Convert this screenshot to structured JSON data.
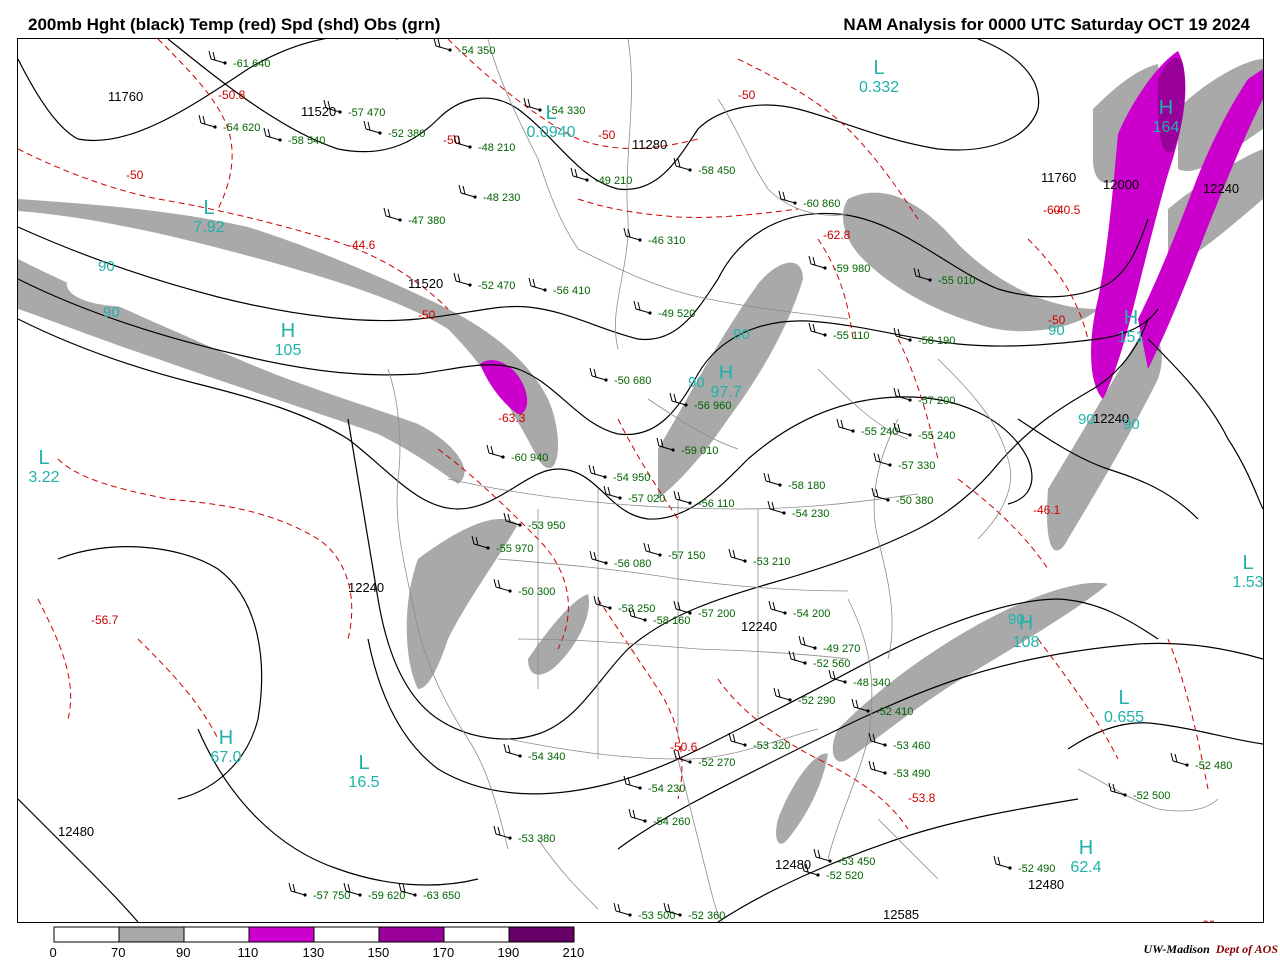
{
  "title_left": "200mb Hght (black) Temp (red) Spd (shd) Obs (grn)",
  "title_right": "NAM Analysis for 0000 UTC Saturday  OCT 19 2024",
  "credit": {
    "org": "UW-Madison",
    "dept": "Dept of AOS"
  },
  "colors": {
    "height": "#000000",
    "temperature": "#cc0000",
    "speed_70_90": "#a9a9a9",
    "speed_110_130": "#cc00cc",
    "speed_150_170": "#990099",
    "speed_190_210": "#660066",
    "observations": "#006400",
    "centers": "#20b2aa",
    "boundaries": "#808080"
  },
  "colorbar": {
    "labels": [
      "0",
      "70",
      "90",
      "110",
      "130",
      "150",
      "170",
      "190",
      "210"
    ],
    "fills": [
      "#ffffff",
      "#a9a9a9",
      "#ffffff",
      "#cc00cc",
      "#ffffff",
      "#990099",
      "#ffffff",
      "#660066"
    ]
  },
  "map": {
    "height_labels": [
      "11760",
      "11520",
      "11280",
      "11520",
      "11760",
      "12000",
      "12240",
      "12240",
      "12240",
      "12240",
      "12480",
      "12480",
      "12480",
      "12585"
    ],
    "temp_labels": [
      "-50.8",
      "-50",
      "-50",
      "-44.6",
      "-50",
      "-50",
      "-50",
      "-62.8",
      "-50",
      "-60",
      "-40.5",
      "-63.3",
      "-46.1",
      "-56.7",
      "-50.6",
      "-53.8",
      "-60"
    ],
    "centers": [
      {
        "type": "L",
        "value": "0.332"
      },
      {
        "type": "L",
        "value": "0.0940"
      },
      {
        "type": "H",
        "value": "164"
      },
      {
        "type": "L",
        "value": "7.92"
      },
      {
        "type": "H",
        "value": "105"
      },
      {
        "type": "H",
        "value": "97.7"
      },
      {
        "type": "H",
        "value": "151"
      },
      {
        "type": "L",
        "value": "3.22"
      },
      {
        "type": "L",
        "value": "1.53"
      },
      {
        "type": "H",
        "value": "108"
      },
      {
        "type": "L",
        "value": "0.655"
      },
      {
        "type": "H",
        "value": "67.0"
      },
      {
        "type": "L",
        "value": "16.5"
      },
      {
        "type": "H",
        "value": "62.4"
      }
    ],
    "speed_labels": [
      "90",
      "90",
      "90",
      "90",
      "90",
      "90",
      "90",
      "90"
    ],
    "obs": [
      "-54 350",
      "-61 640",
      "-54 620",
      "-58 540",
      "-57 470",
      "-52 380",
      "-48 210",
      "-54 330",
      "-49 210",
      "-58 450",
      "-48 230",
      "-46 310",
      "-47 380",
      "-52 470",
      "-56 410",
      "-49 520",
      "-50 680",
      "-56 960",
      "-59 010",
      "-60 940",
      "-54 950",
      "-57 020",
      "-56 110",
      "-58 180",
      "-54 230",
      "-53 950",
      "-55 970",
      "-56 080",
      "-57 150",
      "-53 210",
      "-53 250",
      "-58 160",
      "-57 200",
      "-54 200",
      "-49 270",
      "-48 340",
      "-52 410",
      "-53 460",
      "-53 490",
      "-53 500",
      "-52 360",
      "-53 450",
      "-52 520",
      "-52 490",
      "-52 500",
      "-52 480",
      "-52 560",
      "-50 300",
      "-53 380",
      "-54 340",
      "-54 230",
      "-54 260",
      "-52 270",
      "-53 320",
      "-52 290",
      "-57 330",
      "-50 380",
      "-55 240",
      "-55 240",
      "-57 200",
      "-58 190",
      "-55 110",
      "-55 010",
      "-59 980",
      "-60 860",
      "-57 750",
      "-59 620",
      "-63 650"
    ]
  }
}
